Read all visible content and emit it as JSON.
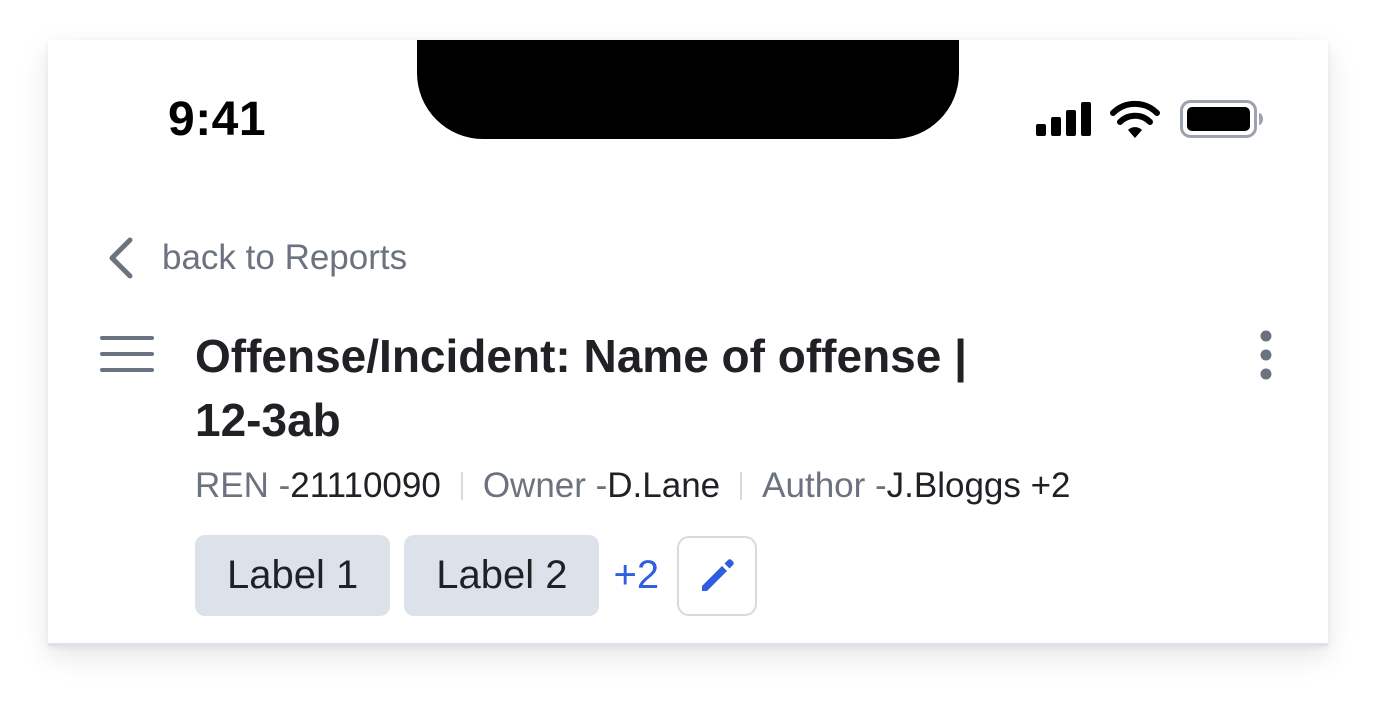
{
  "status_bar": {
    "time": "9:41",
    "icons": [
      "signal-icon",
      "wifi-icon",
      "battery-icon"
    ]
  },
  "nav": {
    "back_label": "back to Reports",
    "back_icon": "chevron-left-icon"
  },
  "header": {
    "menu_icon": "hamburger-menu-icon",
    "title_line1": "Offense/Incident: Name of offense |",
    "title_line2": "12-3ab",
    "more_icon": "more-vertical-icon"
  },
  "meta": {
    "ren_key": "REN - ",
    "ren_value": "21110090",
    "owner_key": "Owner - ",
    "owner_value": "D.Lane",
    "author_key": "Author - ",
    "author_value": "J.Bloggs +2"
  },
  "labels": {
    "items": [
      "Label 1",
      "Label 2"
    ],
    "more": "+2",
    "edit_icon": "pencil-icon"
  },
  "colors": {
    "accent": "#2f5fe0",
    "chip_bg": "#dde2ea",
    "muted_text": "#6b7280",
    "text": "#1f2125"
  }
}
